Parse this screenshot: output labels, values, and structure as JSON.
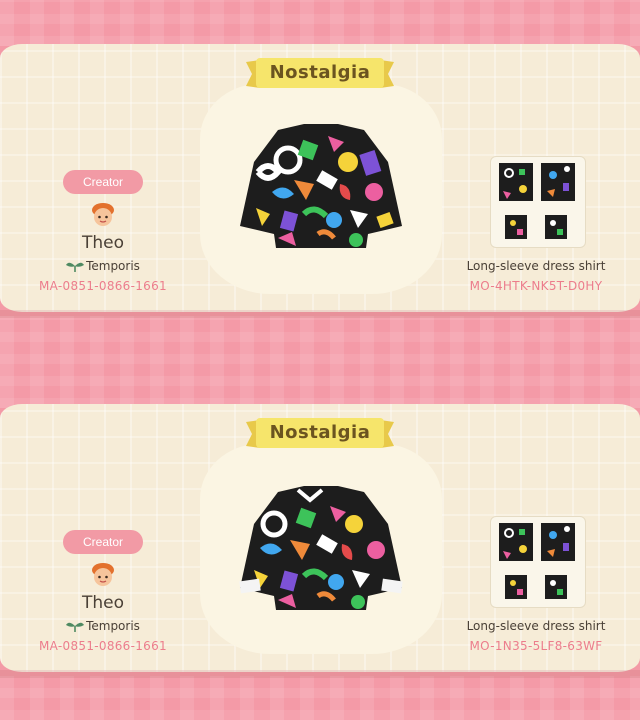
{
  "cards": [
    {
      "title": "Nostalgia",
      "creator_label": "Creator",
      "creator_name": "Theo",
      "island": "Temporis",
      "creator_code": "MA-0851-0866-1661",
      "item_name": "Long-sleeve dress shirt",
      "design_code": "MO-4HTK-NK5T-D0HY"
    },
    {
      "title": "Nostalgia",
      "creator_label": "Creator",
      "creator_name": "Theo",
      "island": "Temporis",
      "creator_code": "MA-0851-0866-1661",
      "item_name": "Long-sleeve dress shirt",
      "design_code": "MO-1N35-5LF8-63WF"
    }
  ],
  "colors": {
    "pink_stripe": "#f49aa7",
    "card_bg": "#f6ecd7",
    "banner_yellow": "#f5e46a",
    "code_pink": "#ec7d8c",
    "text_dark": "#4a4036"
  },
  "icons": [
    "avatar-icon",
    "leaf-icon",
    "shirt-pattern"
  ]
}
